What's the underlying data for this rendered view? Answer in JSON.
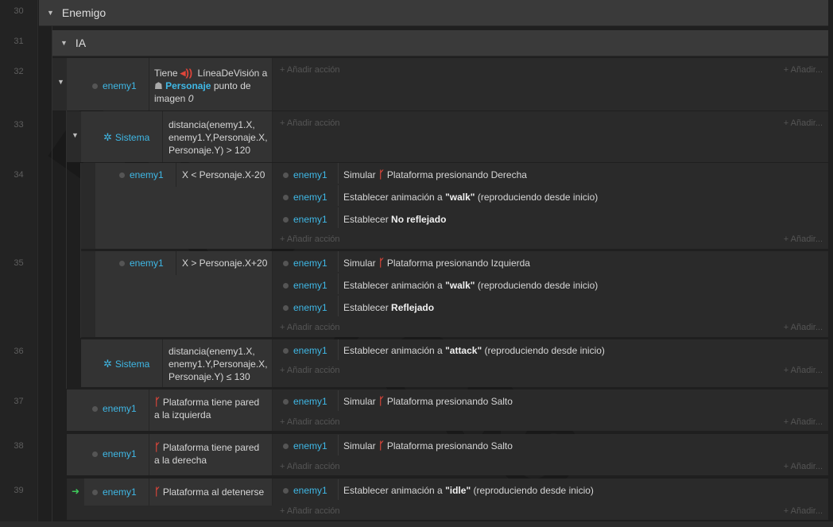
{
  "line_numbers": [
    "30",
    "31",
    "32",
    "33",
    "34",
    "35",
    "36",
    "37",
    "38",
    "39"
  ],
  "groups": {
    "enemigo": "Enemigo",
    "ia": "IA"
  },
  "add_action": "+ Añadir acción",
  "add_right": "+ Añadir...",
  "objects": {
    "enemy1": "enemy1",
    "sistema": "Sistema"
  },
  "events": {
    "e32": {
      "tiene": "Tiene",
      "linea": "LíneaDeVisión a",
      "personaje": "Personaje",
      "punto": "punto de",
      "imagen": "imagen",
      "zero": "0"
    },
    "e33": {
      "c1": "distancia(enemy1.X,",
      "c2": "enemy1.Y,Personaje.X,",
      "c3": "Personaje.Y) > 120"
    },
    "e34": {
      "cond": "X < Personaje.X-20",
      "a1_pre": "Simular",
      "a1_post": "Plataforma presionando Derecha",
      "a2_pre": "Establecer animación a",
      "a2_b": "\"walk\"",
      "a2_post": "(reproduciendo desde inicio)",
      "a3_pre": "Establecer",
      "a3_b": "No reflejado"
    },
    "e35": {
      "cond": "X > Personaje.X+20",
      "a1_pre": "Simular",
      "a1_post": "Plataforma presionando Izquierda",
      "a2_pre": "Establecer animación a",
      "a2_b": "\"walk\"",
      "a2_post": "(reproduciendo desde inicio)",
      "a3_pre": "Establecer",
      "a3_b": "Reflejado"
    },
    "e36": {
      "c1": "distancia(enemy1.X,",
      "c2": "enemy1.Y,Personaje.X,",
      "c3": "Personaje.Y) ≤ 130",
      "a1_pre": "Establecer animación a",
      "a1_b": "\"attack\"",
      "a1_post": "(reproduciendo desde inicio)"
    },
    "e37": {
      "c1": "Plataforma tiene pared",
      "c2": "a la izquierda",
      "a1_pre": "Simular",
      "a1_post": "Plataforma presionando Salto"
    },
    "e38": {
      "c1": "Plataforma tiene pared",
      "c2": "a la derecha",
      "a1_pre": "Simular",
      "a1_post": "Plataforma presionando Salto"
    },
    "e39": {
      "c1": "Plataforma al detenerse",
      "a1_pre": "Establecer animación a",
      "a1_b": "\"idle\"",
      "a1_post": "(reproduciendo desde inicio)"
    }
  },
  "colors": {
    "accent": "#3fb8e6",
    "behavior": "#e0453a",
    "trigger": "#3ec95a"
  }
}
